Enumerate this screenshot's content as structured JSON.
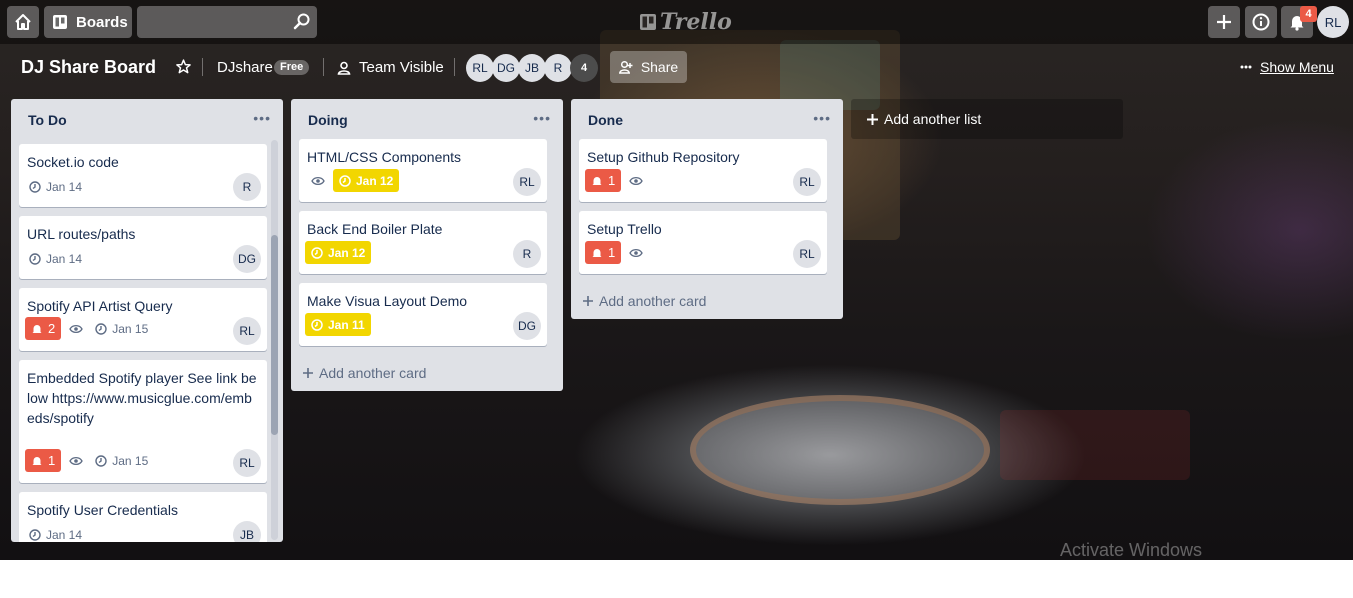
{
  "header": {
    "boards_label": "Boards",
    "search_placeholder": "",
    "logo_text": "Trello",
    "notifications_count": "4",
    "user_initials": "RL"
  },
  "board": {
    "title": "DJ Share Board",
    "team_name": "DJshare",
    "team_plan": "Free",
    "visibility": "Team Visible",
    "members": [
      "RL",
      "DG",
      "JB",
      "R"
    ],
    "member_overflow": "4",
    "share_label": "Share",
    "menu_label": "Show Menu",
    "add_list_label": "Add another list"
  },
  "lists": [
    {
      "title": "To Do",
      "cards": [
        {
          "title": "Socket.io code",
          "due": "Jan 14",
          "member": "R"
        },
        {
          "title": "URL routes/paths",
          "due": "Jan 14",
          "member": "DG"
        },
        {
          "title": "Spotify API Artist Query",
          "alerts": "2",
          "due": "Jan 15",
          "member": "RL"
        },
        {
          "title": "Embedded Spotify player See link below https://www.musicglue.com/embeds/spotify",
          "alerts": "1",
          "due": "Jan 15",
          "member": "RL"
        },
        {
          "title": "Spotify User Credentials",
          "due": "Jan 14",
          "member": "JB"
        }
      ]
    },
    {
      "title": "Doing",
      "cards": [
        {
          "title": "HTML/CSS Components",
          "due": "Jan 12",
          "member": "RL"
        },
        {
          "title": "Back End Boiler Plate",
          "due": "Jan 12",
          "member": "R"
        },
        {
          "title": "Make Visua Layout Demo",
          "due": "Jan 11",
          "member": "DG"
        }
      ],
      "add_card_label": "Add another card"
    },
    {
      "title": "Done",
      "cards": [
        {
          "title": "Setup Github Repository",
          "alerts": "1",
          "member": "RL"
        },
        {
          "title": "Setup Trello",
          "alerts": "1",
          "member": "RL"
        }
      ],
      "add_card_label": "Add another card"
    }
  ],
  "watermark": "Activate Windows",
  "colors": {
    "due_yellow": "#f2d600",
    "alert_red": "#eb5a46",
    "list_bg": "#dfe1e6"
  }
}
